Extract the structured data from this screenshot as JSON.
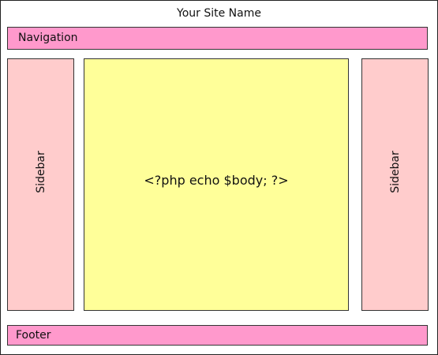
{
  "site_name": "Your Site Name",
  "navigation": {
    "label": "Navigation",
    "color": "#ff99cc"
  },
  "sidebar_left": {
    "label": "Sidebar",
    "color": "#ffcccc"
  },
  "main": {
    "label": "<?php echo $body; ?>",
    "color": "#ffff99"
  },
  "sidebar_right": {
    "label": "Sidebar",
    "color": "#ffcccc"
  },
  "footer": {
    "label": "Footer",
    "color": "#ff99cc"
  }
}
